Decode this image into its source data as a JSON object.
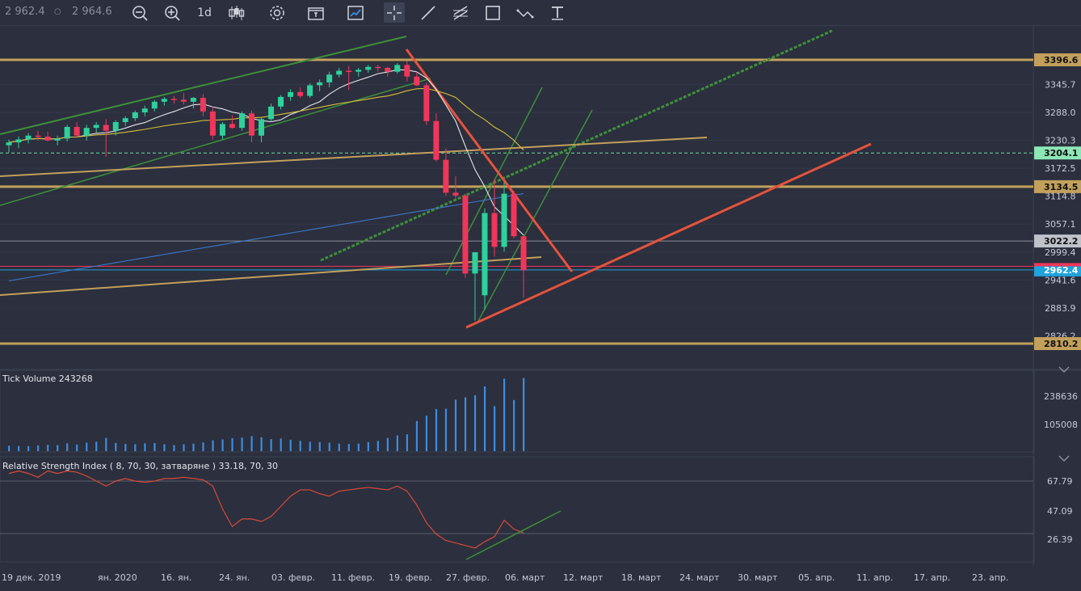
{
  "toolbar": {
    "bid": "2 962.4",
    "ask": "2 964.6",
    "timeframe": "1d",
    "buttons": [
      "zoom-out-icon",
      "zoom-in-icon",
      "timeframe",
      "candles-icon",
      "settings-icon",
      "template-icon",
      "chart-type-icon",
      "crosshair-icon",
      "trendline-icon",
      "channel-icon",
      "rectangle-icon",
      "wave-icon",
      "text-icon"
    ]
  },
  "colors": {
    "background": "#2b2f3e",
    "bull": "#2ed19b",
    "bear": "#f0365a",
    "level": "#c2a05c",
    "trend": "#e5533d",
    "channel": "#3f8f3a",
    "price_tag": "#1fa3dd",
    "volume": "#3d8de0",
    "rsi": "#d94a3a"
  },
  "main_axis": {
    "labels": [
      "3345.7",
      "3288.0",
      "3230.3",
      "3172.5",
      "3114.8",
      "3057.1",
      "2999.4",
      "2941.6",
      "2883.9",
      "2826.2"
    ],
    "tags": [
      {
        "label": "3396.6",
        "kind": "level"
      },
      {
        "label": "3204.1",
        "kind": "dashed"
      },
      {
        "label": "3134.5",
        "kind": "level"
      },
      {
        "label": "3022.2",
        "kind": "grey"
      },
      {
        "label": "2962.4",
        "kind": "bid"
      },
      {
        "label": "2810.2",
        "kind": "level"
      }
    ]
  },
  "volume": {
    "title": "Tick Volume 243268",
    "axis": [
      "238636",
      "105008"
    ]
  },
  "rsi": {
    "title": "Relative Strength Index ( 8, 70, 30, затваряне ) 33.18, 70, 30",
    "axis": [
      "67.79",
      "47.09",
      "26.39"
    ]
  },
  "time_axis": [
    "19 дек. 2019",
    "ян. 2020",
    "16. ян.",
    "24. ян.",
    "03. февр.",
    "11. февр.",
    "19. февр.",
    "27. февр.",
    "06. март",
    "12. март",
    "18. март",
    "24. март",
    "30. март",
    "05. апр.",
    "11. апр.",
    "17. апр.",
    "23. апр."
  ],
  "chart_data": {
    "type": "candlestick",
    "instrument_price_scale": [
      2810.2,
      3396.6
    ],
    "candles": [
      {
        "o": 3220,
        "h": 3232,
        "l": 3205,
        "c": 3226
      },
      {
        "o": 3226,
        "h": 3238,
        "l": 3214,
        "c": 3232
      },
      {
        "o": 3232,
        "h": 3245,
        "l": 3224,
        "c": 3240
      },
      {
        "o": 3240,
        "h": 3250,
        "l": 3230,
        "c": 3238
      },
      {
        "o": 3238,
        "h": 3248,
        "l": 3228,
        "c": 3230
      },
      {
        "o": 3230,
        "h": 3240,
        "l": 3220,
        "c": 3234
      },
      {
        "o": 3234,
        "h": 3262,
        "l": 3228,
        "c": 3258
      },
      {
        "o": 3258,
        "h": 3268,
        "l": 3236,
        "c": 3240
      },
      {
        "o": 3240,
        "h": 3262,
        "l": 3230,
        "c": 3256
      },
      {
        "o": 3256,
        "h": 3268,
        "l": 3246,
        "c": 3262
      },
      {
        "o": 3262,
        "h": 3274,
        "l": 3196,
        "c": 3250
      },
      {
        "o": 3250,
        "h": 3272,
        "l": 3240,
        "c": 3268
      },
      {
        "o": 3268,
        "h": 3280,
        "l": 3260,
        "c": 3276
      },
      {
        "o": 3276,
        "h": 3292,
        "l": 3270,
        "c": 3288
      },
      {
        "o": 3288,
        "h": 3302,
        "l": 3280,
        "c": 3296
      },
      {
        "o": 3296,
        "h": 3314,
        "l": 3290,
        "c": 3310
      },
      {
        "o": 3310,
        "h": 3320,
        "l": 3302,
        "c": 3316
      },
      {
        "o": 3316,
        "h": 3322,
        "l": 3306,
        "c": 3314
      },
      {
        "o": 3314,
        "h": 3328,
        "l": 3304,
        "c": 3310
      },
      {
        "o": 3310,
        "h": 3320,
        "l": 3296,
        "c": 3318
      },
      {
        "o": 3318,
        "h": 3326,
        "l": 3280,
        "c": 3290
      },
      {
        "o": 3290,
        "h": 3300,
        "l": 3232,
        "c": 3240
      },
      {
        "o": 3240,
        "h": 3268,
        "l": 3232,
        "c": 3264
      },
      {
        "o": 3264,
        "h": 3282,
        "l": 3254,
        "c": 3256
      },
      {
        "o": 3256,
        "h": 3290,
        "l": 3250,
        "c": 3286
      },
      {
        "o": 3286,
        "h": 3292,
        "l": 3226,
        "c": 3240
      },
      {
        "o": 3240,
        "h": 3278,
        "l": 3226,
        "c": 3274
      },
      {
        "o": 3274,
        "h": 3306,
        "l": 3268,
        "c": 3300
      },
      {
        "o": 3300,
        "h": 3324,
        "l": 3294,
        "c": 3320
      },
      {
        "o": 3320,
        "h": 3336,
        "l": 3312,
        "c": 3330
      },
      {
        "o": 3330,
        "h": 3340,
        "l": 3318,
        "c": 3322
      },
      {
        "o": 3322,
        "h": 3348,
        "l": 3318,
        "c": 3344
      },
      {
        "o": 3344,
        "h": 3356,
        "l": 3332,
        "c": 3350
      },
      {
        "o": 3350,
        "h": 3372,
        "l": 3340,
        "c": 3366
      },
      {
        "o": 3366,
        "h": 3380,
        "l": 3360,
        "c": 3374
      },
      {
        "o": 3374,
        "h": 3384,
        "l": 3334,
        "c": 3372
      },
      {
        "o": 3372,
        "h": 3380,
        "l": 3362,
        "c": 3376
      },
      {
        "o": 3376,
        "h": 3386,
        "l": 3370,
        "c": 3382
      },
      {
        "o": 3382,
        "h": 3386,
        "l": 3372,
        "c": 3380
      },
      {
        "o": 3380,
        "h": 3382,
        "l": 3362,
        "c": 3372
      },
      {
        "o": 3372,
        "h": 3390,
        "l": 3368,
        "c": 3386
      },
      {
        "o": 3386,
        "h": 3394,
        "l": 3352,
        "c": 3362
      },
      {
        "o": 3362,
        "h": 3372,
        "l": 3342,
        "c": 3344
      },
      {
        "o": 3344,
        "h": 3350,
        "l": 3262,
        "c": 3270
      },
      {
        "o": 3270,
        "h": 3286,
        "l": 3186,
        "c": 3190
      },
      {
        "o": 3190,
        "h": 3214,
        "l": 3116,
        "c": 3122
      },
      {
        "o": 3122,
        "h": 3156,
        "l": 3110,
        "c": 3116
      },
      {
        "o": 3116,
        "h": 3120,
        "l": 2946,
        "c": 2955
      },
      {
        "o": 2955,
        "h": 2999,
        "l": 2858,
        "c": 2999
      },
      {
        "o": 2910,
        "h": 3090,
        "l": 2880,
        "c": 3080
      },
      {
        "o": 3080,
        "h": 3150,
        "l": 2990,
        "c": 3010
      },
      {
        "o": 3010,
        "h": 3144,
        "l": 3000,
        "c": 3120
      },
      {
        "o": 3120,
        "h": 3126,
        "l": 3028,
        "c": 3032
      },
      {
        "o": 3032,
        "h": 3034,
        "l": 2905,
        "c": 2962
      }
    ],
    "volume": [
      18000,
      17000,
      16500,
      19000,
      21000,
      20000,
      26000,
      22000,
      28000,
      31000,
      44000,
      27000,
      24000,
      23000,
      26000,
      27000,
      23000,
      20000,
      23000,
      25000,
      29000,
      36000,
      39000,
      43000,
      45000,
      50000,
      46000,
      40000,
      42000,
      38000,
      34000,
      31000,
      30000,
      28000,
      25000,
      24000,
      25000,
      30000,
      34000,
      44000,
      52000,
      56000,
      100000,
      118000,
      140000,
      141000,
      171000,
      179000,
      186000,
      215000,
      149000,
      241000,
      170000,
      243268
    ],
    "rsi": [
      80,
      82,
      80,
      77,
      82,
      80,
      82,
      81,
      78,
      74,
      70,
      74,
      76,
      74,
      73,
      74,
      76,
      76,
      77,
      76,
      75,
      70,
      52,
      38,
      44,
      44,
      42,
      46,
      54,
      62,
      67,
      67,
      64,
      62,
      66,
      67,
      68,
      69,
      68,
      67,
      70,
      66,
      55,
      41,
      32,
      27,
      25,
      23,
      21,
      26,
      30,
      43,
      36,
      33
    ]
  }
}
